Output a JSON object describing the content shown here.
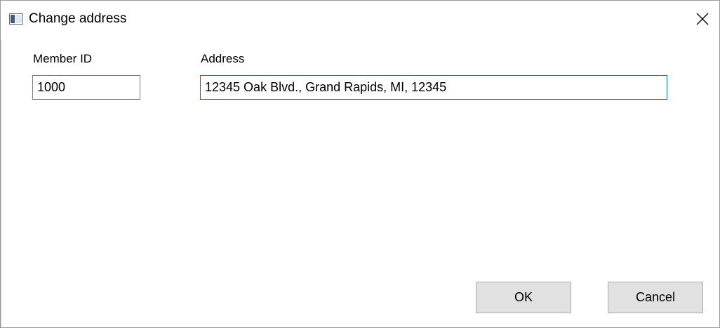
{
  "window": {
    "title": "Change address",
    "close_glyph": "×",
    "icon": "app-window-icon"
  },
  "form": {
    "member_id_label": "Member ID",
    "member_id_value": "1000",
    "address_label": "Address",
    "address_value": "12345 Oak Blvd., Grand Rapids, MI, 12345"
  },
  "buttons": {
    "ok_label": "OK",
    "cancel_label": "Cancel"
  },
  "colors": {
    "focus_border": "#0078d7",
    "button_face": "#e1e1e1",
    "input_border": "#7a7a7a"
  }
}
